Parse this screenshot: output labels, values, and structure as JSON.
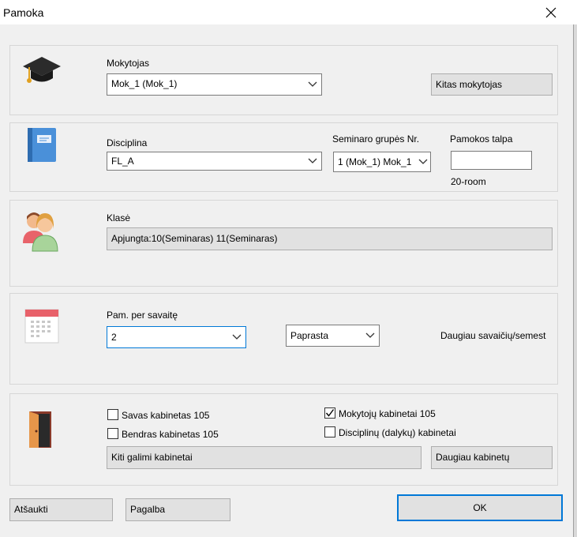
{
  "window": {
    "title": "Pamoka"
  },
  "teacher": {
    "label": "Mokytojas",
    "selected": "Mok_1 (Mok_1)",
    "other_button": "Kitas mokytojas"
  },
  "discipline": {
    "label": "Disciplina",
    "selected": "FL_A",
    "seminar_group_label": "Seminaro grupės Nr.",
    "seminar_group_selected": "1 (Mok_1) Mok_1",
    "capacity_label": "Pamokos talpa",
    "capacity_value": "",
    "room_note": "20-room"
  },
  "class": {
    "label": "Klasė",
    "value": "Apjungta:10(Seminaras) 11(Seminaras)"
  },
  "weekly": {
    "label": "Pam. per savaitę",
    "count": "2",
    "type_selected": "Paprasta",
    "more_weeks": "Daugiau savaičių/semest"
  },
  "rooms": {
    "own_room": {
      "label": "Savas kabinetas 105",
      "checked": false
    },
    "shared_room": {
      "label": "Bendras kabinetas 105",
      "checked": false
    },
    "teacher_rooms": {
      "label": "Mokytojų kabinetai 105",
      "checked": true
    },
    "subject_room": {
      "label": "Disciplinų (dalykų) kabinetai",
      "checked": false
    },
    "other_rooms_button": "Kiti galimi kabinetai",
    "more_rooms_button": "Daugiau kabinetų"
  },
  "footer": {
    "cancel_button": "Atšaukti",
    "help_button": "Pagalba",
    "ok_button": "OK"
  }
}
